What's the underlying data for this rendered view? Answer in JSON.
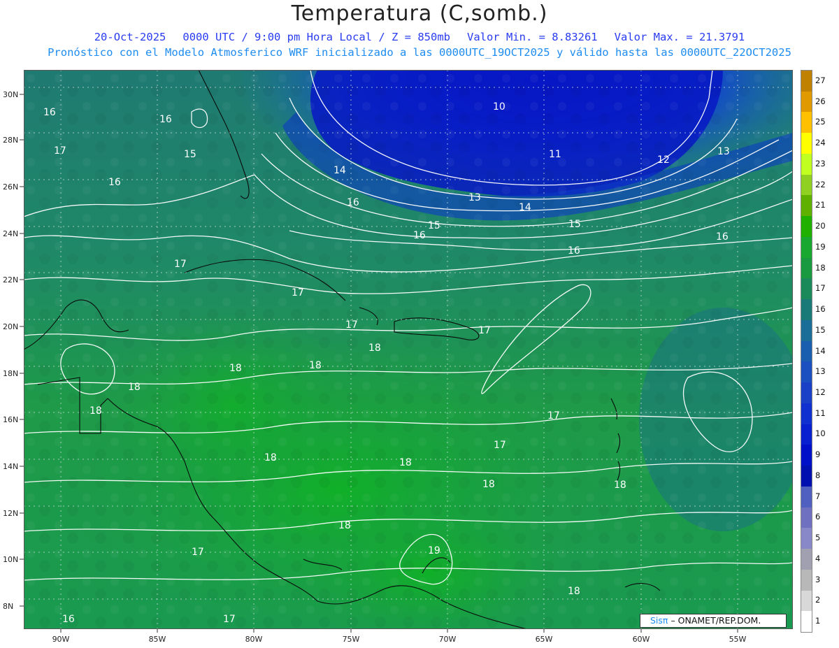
{
  "header": {
    "title": "Temperatura (C,somb.)",
    "date": "20-Oct-2025",
    "time": "0000 UTC / 9:00 pm Hora Local / Z = 850mb",
    "vmin": "Valor Min. = 8.83261",
    "vmax": "Valor Max. = 21.3791",
    "model_line": "Pronóstico con el Modelo Atmosferico WRF inicializado a las 0000UTC_19OCT2025 y válido hasta las  0000UTC_22OCT2025"
  },
  "map": {
    "lat_labels": [
      "30N",
      "28N",
      "26N",
      "24N",
      "22N",
      "20N",
      "18N",
      "16N",
      "14N",
      "12N",
      "10N",
      "8N"
    ],
    "lon_labels": [
      "90W",
      "85W",
      "80W",
      "75W",
      "70W",
      "65W",
      "60W",
      "55W"
    ],
    "contour_labels": [
      {
        "text": "16"
      },
      {
        "text": "16"
      },
      {
        "text": "17"
      },
      {
        "text": "15"
      },
      {
        "text": "16"
      },
      {
        "text": "10"
      },
      {
        "text": "11"
      },
      {
        "text": "12"
      },
      {
        "text": "13"
      },
      {
        "text": "14"
      },
      {
        "text": "13"
      },
      {
        "text": "14"
      },
      {
        "text": "15"
      },
      {
        "text": "15"
      },
      {
        "text": "16"
      },
      {
        "text": "16"
      },
      {
        "text": "16"
      },
      {
        "text": "16"
      },
      {
        "text": "17"
      },
      {
        "text": "17"
      },
      {
        "text": "17"
      },
      {
        "text": "18"
      },
      {
        "text": "18"
      },
      {
        "text": "18"
      },
      {
        "text": "18"
      },
      {
        "text": "18"
      },
      {
        "text": "17"
      },
      {
        "text": "17"
      },
      {
        "text": "17"
      },
      {
        "text": "18"
      },
      {
        "text": "18"
      },
      {
        "text": "18"
      },
      {
        "text": "18"
      },
      {
        "text": "18"
      },
      {
        "text": "19"
      },
      {
        "text": "17"
      },
      {
        "text": "18"
      },
      {
        "text": "16"
      },
      {
        "text": "17"
      }
    ],
    "colors": {
      "ocean_deep": "#0a2fc8",
      "cool": "#1a6fb0",
      "mid": "#1f8a6e",
      "warm": "#1fa040",
      "warmest": "#14b030"
    }
  },
  "colorbar": {
    "levels": [
      "27",
      "26",
      "25",
      "24",
      "23",
      "22",
      "21",
      "20",
      "19",
      "18",
      "17",
      "16",
      "15",
      "14",
      "13",
      "12",
      "11",
      "10",
      "9",
      "8",
      "7",
      "6",
      "5",
      "4",
      "3",
      "2",
      "1"
    ],
    "colors": [
      "#c08000",
      "#e09a00",
      "#ffc000",
      "#ffff00",
      "#c0ff20",
      "#90d020",
      "#60b000",
      "#20b000",
      "#18a830",
      "#1a9a40",
      "#1a8a5a",
      "#1a7a78",
      "#1a6e98",
      "#1a5eb0",
      "#1a50c0",
      "#1a40c8",
      "#1030d0",
      "#0820d0",
      "#0010c8",
      "#0010b0",
      "#5060c0",
      "#7070c0",
      "#8888c8",
      "#a0a0b0",
      "#b8b8b8",
      "#d8d8d8",
      "#ffffff"
    ]
  },
  "credit": {
    "brand": "Sisπ",
    "text": "– ONAMET/REP.DOM."
  }
}
